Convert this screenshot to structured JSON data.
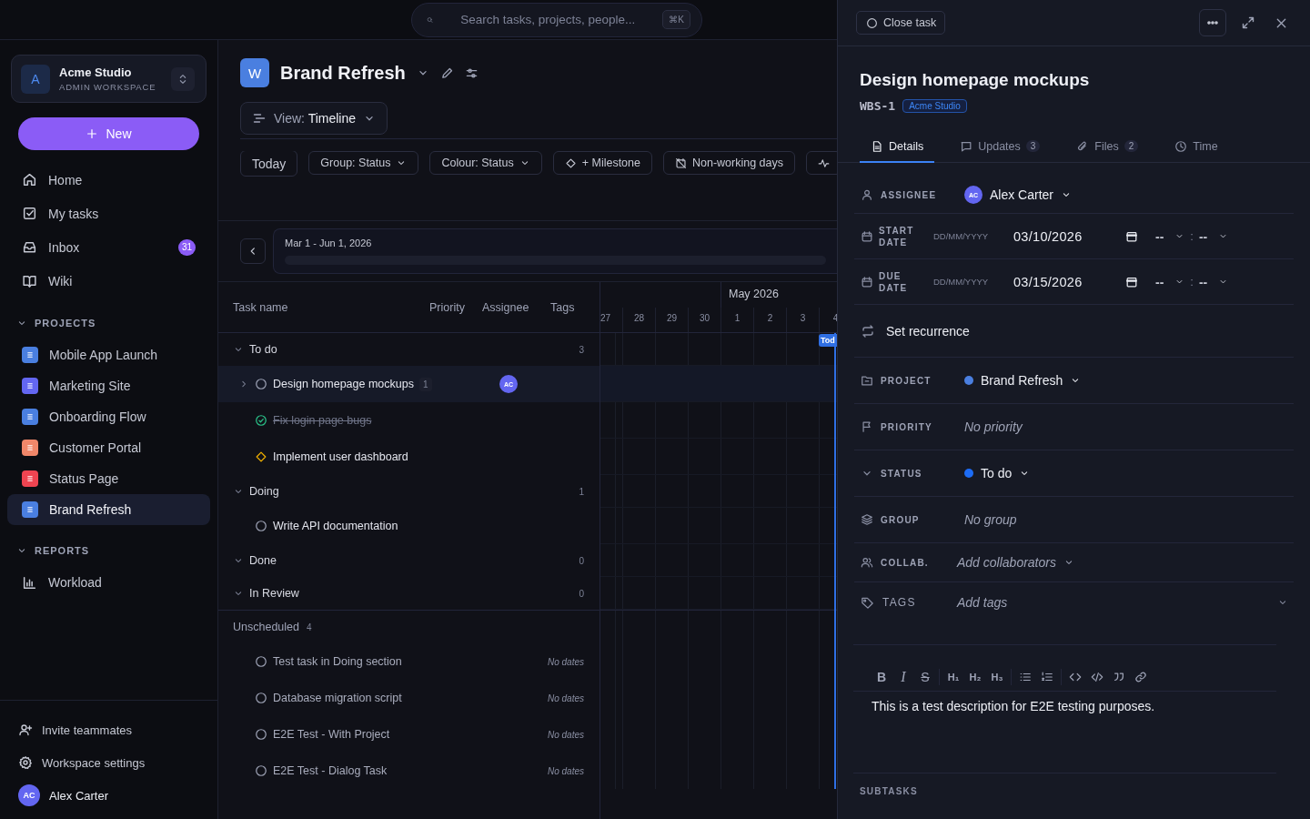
{
  "search": {
    "placeholder": "Search tasks, projects, people...",
    "shortcut": "⌘K"
  },
  "workspace": {
    "avatar": "A",
    "name": "Acme Studio",
    "role": "ADMIN WORKSPACE"
  },
  "new_button": "New",
  "nav": [
    {
      "label": "Home",
      "kind": "home",
      "selected": false
    },
    {
      "label": "My tasks",
      "kind": "tasks",
      "selected": false
    },
    {
      "label": "Inbox",
      "kind": "inbox",
      "badge": "31",
      "selected": false
    },
    {
      "label": "Wiki",
      "kind": "wiki",
      "selected": false
    }
  ],
  "projects": {
    "title": "PROJECTS",
    "expanded": true,
    "items": [
      {
        "label": "Mobile App Launch",
        "color": "#4a7fe0",
        "selected": false
      },
      {
        "label": "Marketing Site",
        "color": "#6366f1",
        "selected": false
      },
      {
        "label": "Onboarding Flow",
        "color": "#4a7fe0",
        "selected": false
      },
      {
        "label": "Customer Portal",
        "color": "#f0876a",
        "selected": false
      },
      {
        "label": "Status Page",
        "color": "#ef4451",
        "selected": false
      },
      {
        "label": "Brand Refresh",
        "color": "#4a7fe0",
        "selected": true
      }
    ]
  },
  "reports": {
    "title": "REPORTS",
    "expanded": true,
    "items": [
      {
        "label": "Workload",
        "selected": false
      }
    ]
  },
  "footer": [
    {
      "label": "Invite teammates",
      "kind": "invite"
    },
    {
      "label": "Workspace settings",
      "kind": "settings"
    }
  ],
  "user": {
    "initials": "AC",
    "name": "Alex Carter"
  },
  "header": {
    "avatar": "W",
    "title": "Brand Refresh"
  },
  "view": {
    "label": "View:",
    "value": "Timeline"
  },
  "toolbar": [
    {
      "label": "Today",
      "kind": "plain"
    },
    {
      "label": "Group: Status",
      "kind": "dropdown"
    },
    {
      "label": "Colour: Status",
      "kind": "dropdown"
    },
    {
      "label": "+ Milestone",
      "kind": "milestone"
    },
    {
      "label": "Non-working days",
      "kind": "calendar"
    },
    {
      "kind": "activity"
    }
  ],
  "range": {
    "label": "Mar 1 - Jun 1, 2026"
  },
  "table": {
    "columns": [
      "Task name",
      "Priority",
      "Assignee",
      "Tags"
    ],
    "groups": [
      {
        "name": "To do",
        "count": "3",
        "expanded": true,
        "tasks": [
          {
            "name": "Design homepage mockups",
            "kind": "open",
            "selected": true,
            "expanded": false,
            "subtasks": "1",
            "assignee": "AC"
          },
          {
            "name": "Fix login page bugs",
            "kind": "done",
            "selected": false
          },
          {
            "name": "Implement user dashboard",
            "kind": "milestone",
            "selected": false
          }
        ]
      },
      {
        "name": "Doing",
        "count": "1",
        "expanded": true,
        "tasks": [
          {
            "name": "Write API documentation",
            "kind": "open",
            "selected": false
          }
        ]
      },
      {
        "name": "Done",
        "count": "0",
        "expanded": true
      },
      {
        "name": "In Review",
        "count": "0",
        "expanded": true
      }
    ],
    "unscheduled": {
      "name": "Unscheduled",
      "count": "4",
      "tasks": [
        {
          "name": "Test task in Doing section",
          "kind": "open",
          "dates": "No dates"
        },
        {
          "name": "Database migration script",
          "kind": "open",
          "dates": "No dates"
        },
        {
          "name": "E2E Test - With Project",
          "kind": "open",
          "dates": "No dates"
        },
        {
          "name": "E2E Test - Dialog Task",
          "kind": "open",
          "dates": "No dates"
        }
      ]
    }
  },
  "timeline": {
    "month": "May 2026",
    "days": [
      "27",
      "28",
      "29",
      "30",
      "1",
      "2",
      "3",
      "4"
    ],
    "today_label": "Tod"
  },
  "panel": {
    "close_task": "Close task",
    "title": "Design homepage mockups",
    "key": "WBS-1",
    "workspace_badge": "Acme Studio",
    "tabs": [
      {
        "label": "Details",
        "kind": "details",
        "selected": true
      },
      {
        "label": "Updates",
        "kind": "updates",
        "count": "3",
        "selected": false
      },
      {
        "label": "Files",
        "kind": "files",
        "count": "2",
        "selected": false
      },
      {
        "label": "Time",
        "kind": "time",
        "selected": false
      }
    ],
    "fields": [
      {
        "kind": "assignee",
        "label": "ASSIGNEE",
        "initials": "AC",
        "value": "Alex Carter"
      },
      {
        "kind": "start",
        "label": "START DATE",
        "placeholder": "DD/MM/YYYY",
        "value": "03/10/2026",
        "hour": "--",
        "separator": ":",
        "minute": "--"
      },
      {
        "kind": "due",
        "label": "DUE DATE",
        "placeholder": "DD/MM/YYYY",
        "value": "03/15/2026",
        "hour": "--",
        "separator": ":",
        "minute": "--"
      },
      {
        "kind": "recurrence",
        "value": "Set recurrence"
      },
      {
        "kind": "project",
        "label": "PROJECT",
        "value": "Brand Refresh",
        "color": "#4a7fe0"
      },
      {
        "kind": "priority",
        "label": "PRIORITY",
        "value": "No priority"
      },
      {
        "kind": "status",
        "label": "STATUS",
        "value": "To do",
        "color": "#1d6cf5"
      },
      {
        "kind": "group",
        "label": "GROUP",
        "value": "No group"
      },
      {
        "kind": "collab",
        "label": "COLLAB.",
        "value": "Add collaborators"
      },
      {
        "kind": "tags",
        "label": "TAGS",
        "value": "Add tags"
      }
    ],
    "editor_tools": [
      [
        {
          "kind": "bold",
          "label": "B"
        },
        {
          "kind": "italic",
          "label": "I"
        },
        {
          "kind": "strike",
          "label": "S"
        }
      ],
      [
        {
          "kind": "heading",
          "label": "H₁"
        },
        {
          "kind": "heading",
          "label": "H₂"
        },
        {
          "kind": "heading",
          "label": "H₃"
        }
      ],
      [
        {
          "kind": "bullet"
        },
        {
          "kind": "ordered"
        }
      ],
      [
        {
          "kind": "code"
        },
        {
          "kind": "codeblock"
        },
        {
          "kind": "quote"
        },
        {
          "kind": "link"
        }
      ]
    ],
    "description": "This is a test description for E2E testing purposes.",
    "subtasks_title": "SUBTASKS"
  }
}
